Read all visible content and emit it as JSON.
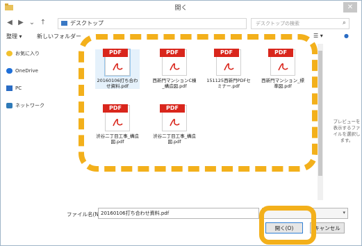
{
  "window": {
    "title": "開く",
    "close_label": "✕"
  },
  "nav": {
    "back": "◀",
    "forward": "▶",
    "dropdown": "⌄",
    "up": "↑",
    "address": "デスクトップ",
    "address_dropdown": "⌄",
    "refresh": "↻",
    "search_placeholder": "デスクトップの検索",
    "search_icon": "⌕"
  },
  "toolbar": {
    "organize": "整理 ▾",
    "new_folder": "新しいフォルダー",
    "view": "☰ ▾",
    "help": "●"
  },
  "sidebar": {
    "items": [
      {
        "label": "お気に入り",
        "icon": "star-icon",
        "color": "#f2c12e"
      },
      {
        "label": "OneDrive",
        "icon": "cloud-icon",
        "color": "#1e6fd9"
      },
      {
        "label": "PC",
        "icon": "pc-icon",
        "color": "#2a6cc4"
      },
      {
        "label": "ネットワーク",
        "icon": "network-icon",
        "color": "#2f7ab8"
      }
    ]
  },
  "files": [
    {
      "badge": "PDF",
      "name": "20160106打ち合わせ資料.pdf",
      "selected": true
    },
    {
      "badge": "PDF",
      "name": "西新門マンションC棟_構造図.pdf",
      "selected": false
    },
    {
      "badge": "PDF",
      "name": "151125西新門PDFセミナー.pdf",
      "selected": false
    },
    {
      "badge": "PDF",
      "name": "西新門マンション_標準図.pdf",
      "selected": false
    },
    {
      "badge": "PDF",
      "name": "渋谷二丁目工事_構造図.pdf",
      "selected": false
    },
    {
      "badge": "PDF",
      "name": "渋谷二丁目工事_構造図.pdf",
      "selected": false
    }
  ],
  "preview_text": "プレビューを表示するファイルを選択します。",
  "bottom": {
    "filename_label": "ファイル名(N):",
    "filename_value": "20160106打ち合わせ資料.pdf",
    "filter_dropdown": "▾",
    "open_label": "開く(O)",
    "cancel_label": "キャンセル"
  },
  "colors": {
    "highlight": "#f3b01b",
    "pdf_red": "#d9261c"
  }
}
